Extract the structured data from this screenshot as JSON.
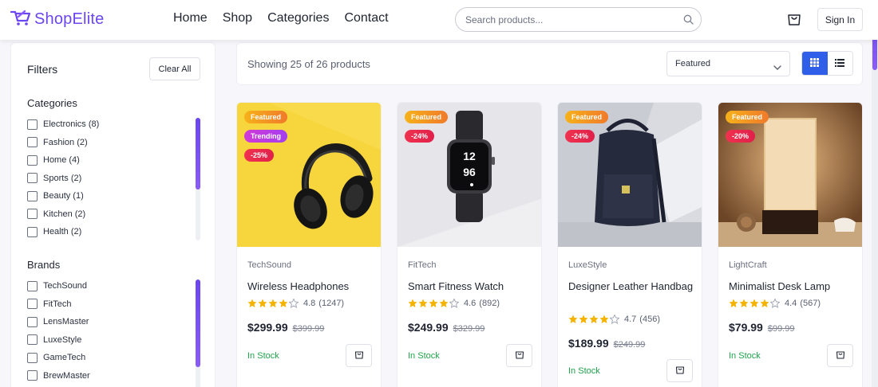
{
  "header": {
    "logo_text": "ShopElite",
    "nav": [
      "Home",
      "Shop",
      "Categories",
      "Contact"
    ],
    "search_placeholder": "Search products...",
    "signin_label": "Sign In"
  },
  "sidebar": {
    "title": "Filters",
    "clear_all": "Clear All",
    "categories_title": "Categories",
    "categories": [
      "Electronics (8)",
      "Fashion (2)",
      "Home (4)",
      "Sports (2)",
      "Beauty (1)",
      "Kitchen (2)",
      "Health (2)"
    ],
    "brands_title": "Brands",
    "brands": [
      "TechSound",
      "FitTech",
      "LensMaster",
      "LuxeStyle",
      "GameTech",
      "BrewMaster"
    ]
  },
  "toolbar": {
    "result_text": "Showing 25 of 26 products",
    "sort_value": "Featured",
    "view_mode": "grid"
  },
  "products": [
    {
      "brand": "TechSound",
      "name": "Wireless Headphones",
      "rating": "4.8",
      "reviews": "(1247)",
      "stars": 4,
      "price": "$299.99",
      "old_price": "$399.99",
      "stock": "In Stock",
      "badges": [
        "Featured",
        "Trending",
        "-25%"
      ],
      "image": "headphones"
    },
    {
      "brand": "FitTech",
      "name": "Smart Fitness Watch",
      "rating": "4.6",
      "reviews": "(892)",
      "stars": 4,
      "price": "$249.99",
      "old_price": "$329.99",
      "stock": "In Stock",
      "badges": [
        "Featured",
        "-24%"
      ],
      "image": "watch"
    },
    {
      "brand": "LuxeStyle",
      "name": "Designer Leather Handbag",
      "rating": "4.7",
      "reviews": "(456)",
      "stars": 4,
      "price": "$189.99",
      "old_price": "$249.99",
      "stock": "In Stock",
      "badges": [
        "Featured",
        "-24%"
      ],
      "image": "backpack"
    },
    {
      "brand": "LightCraft",
      "name": "Minimalist Desk Lamp",
      "rating": "4.4",
      "reviews": "(567)",
      "stars": 4,
      "price": "$79.99",
      "old_price": "$99.99",
      "stock": "In Stock",
      "badges": [
        "Featured",
        "-20%"
      ],
      "image": "lamp"
    }
  ],
  "colors": {
    "brand": "#6b46f0",
    "accent_blue": "#2f5fe8",
    "in_stock": "#1fa34a",
    "star": "#f5b301"
  }
}
